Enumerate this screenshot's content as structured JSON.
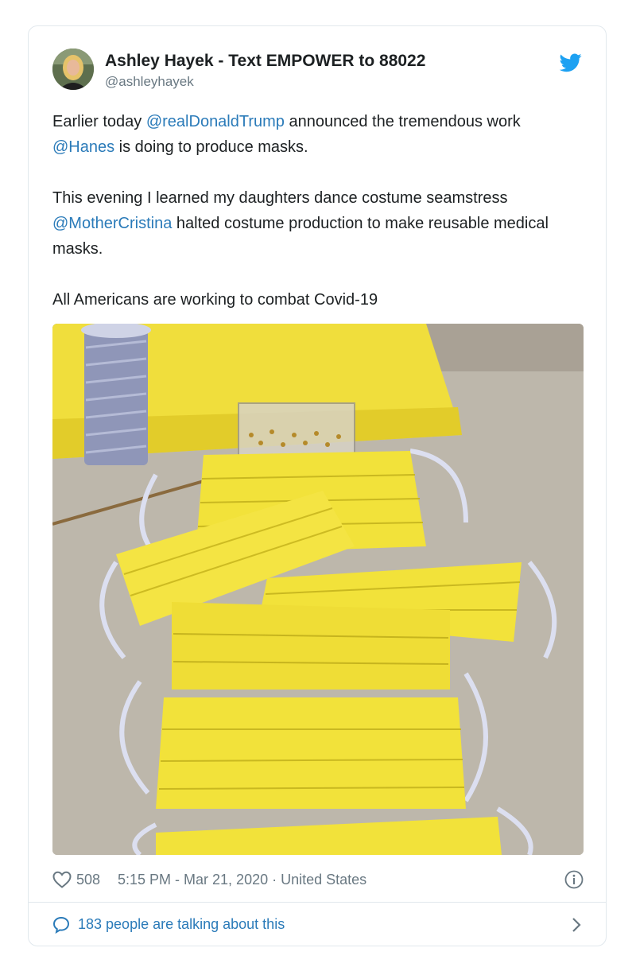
{
  "tweet": {
    "author_name": "Ashley Hayek - Text EMPOWER to 88022",
    "author_handle": "@ashleyhayek",
    "paragraph1": {
      "t1": "Earlier today ",
      "mention1": "@realDonaldTrump",
      "t2": " announced the tremendous work ",
      "mention2": "@Hanes",
      "t3": " is doing to produce masks."
    },
    "paragraph2": {
      "t1": "This evening I learned my daughters dance costume seamstress ",
      "mention1": "@MotherCristina",
      "t2": " halted costume production to make reusable medical masks."
    },
    "paragraph3": "All Americans are working to combat Covid-19",
    "likes": "508",
    "timestamp": "5:15 PM - Mar 21, 2020 · United States",
    "talking": "183 people are talking about this"
  },
  "colors": {
    "link": "#2b7bb9",
    "twitter_blue": "#1da1f2",
    "muted": "#697882",
    "border": "#e1e8ed",
    "mask_yellow": "#f2e23a"
  },
  "icons": {
    "brand": "twitter-bird-icon",
    "like": "heart-icon",
    "info": "info-icon",
    "reply": "speech-bubble-icon",
    "more": "chevron-right-icon"
  }
}
